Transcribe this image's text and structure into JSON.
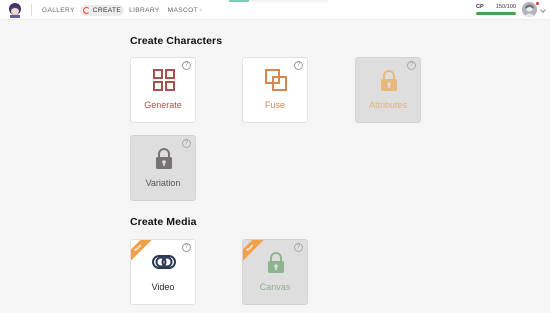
{
  "nav": {
    "items": [
      {
        "label": "GALLERY",
        "active": false
      },
      {
        "label": "CREATE",
        "active": true
      },
      {
        "label": "LIBRARY",
        "active": false
      },
      {
        "label": "MASCOT",
        "active": false
      }
    ],
    "mascot_suffix": "⠦"
  },
  "cp": {
    "label": "CP",
    "value": "150/100",
    "progress": 1.0
  },
  "sections": [
    {
      "title": "Create Characters",
      "cards": [
        {
          "label": "Generate",
          "icon": "grid-icon",
          "disabled": false,
          "badge": "",
          "color": "#a8524b"
        },
        {
          "label": "Fuse",
          "icon": "fuse-icon",
          "disabled": false,
          "badge": "",
          "color": "#d9874a"
        },
        {
          "label": "Attributes",
          "icon": "lock-icon",
          "disabled": true,
          "badge": "",
          "color": "#e9b97c"
        },
        {
          "label": "Variation",
          "icon": "lock-icon",
          "disabled": true,
          "badge": "",
          "color": "#7a7272"
        }
      ]
    },
    {
      "title": "Create Media",
      "cards": [
        {
          "label": "Video",
          "icon": "video-icon",
          "disabled": false,
          "badge": "New",
          "color": "#2d3a55"
        },
        {
          "label": "Canvas",
          "icon": "lock-icon",
          "disabled": true,
          "badge": "New",
          "color": "#8fb38f"
        }
      ]
    }
  ],
  "help_glyph": "?"
}
